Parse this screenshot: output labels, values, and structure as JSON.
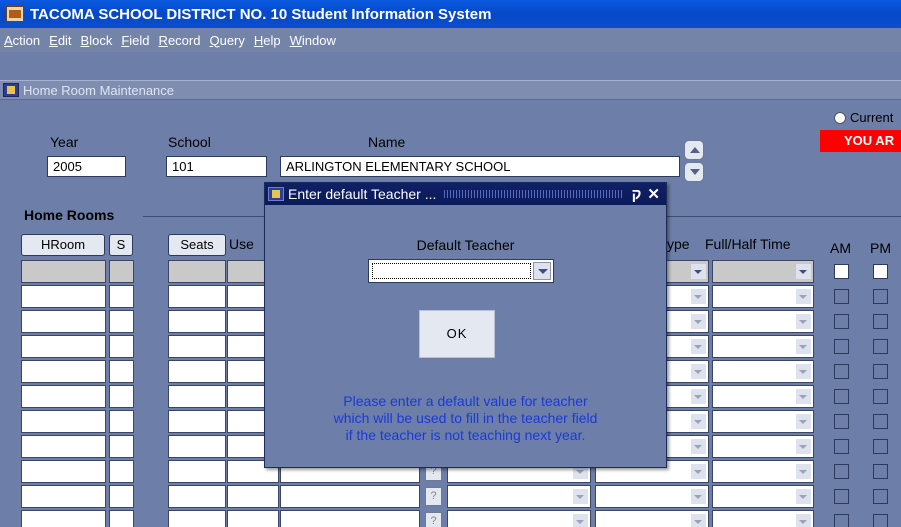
{
  "window": {
    "title": "TACOMA SCHOOL DISTRICT NO. 10 Student Information System"
  },
  "menu": [
    {
      "pre": "",
      "u": "A",
      "post": "ction"
    },
    {
      "pre": "",
      "u": "E",
      "post": "dit"
    },
    {
      "pre": "",
      "u": "B",
      "post": "lock"
    },
    {
      "pre": "",
      "u": "F",
      "post": "ield"
    },
    {
      "pre": "",
      "u": "R",
      "post": "ecord"
    },
    {
      "pre": "",
      "u": "Q",
      "post": "uery"
    },
    {
      "pre": "",
      "u": "H",
      "post": "elp"
    },
    {
      "pre": "",
      "u": "W",
      "post": "indow"
    }
  ],
  "form": {
    "title": "Home Room Maintenance",
    "year_label": "Year",
    "year_value": "2005",
    "school_label": "School",
    "school_value": "101",
    "name_label": "Name",
    "name_value": "ARLINGTON ELEMENTARY SCHOOL",
    "current_radio_label": "Current",
    "warning": "YOU AR",
    "home_rooms_label": "Home Rooms",
    "col_hroom": "HRoom",
    "col_s": "S",
    "col_seats": "Seats",
    "col_use": "Use",
    "col_type": "ype",
    "col_fullhalf": "Full/Half Time",
    "col_am": "AM",
    "col_pm": "PM",
    "question_mark": "?"
  },
  "dialog": {
    "title": "Enter default Teacher ...",
    "minimize_glyph": "ק",
    "close_glyph": "✕",
    "default_teacher_label": "Default Teacher",
    "teacher_value": "",
    "ok_label": "OK",
    "message_line1": "Please enter a default value for teacher",
    "message_line2": "which will be used to fill in the teacher field",
    "message_line3": "if the teacher is not teaching next year."
  }
}
